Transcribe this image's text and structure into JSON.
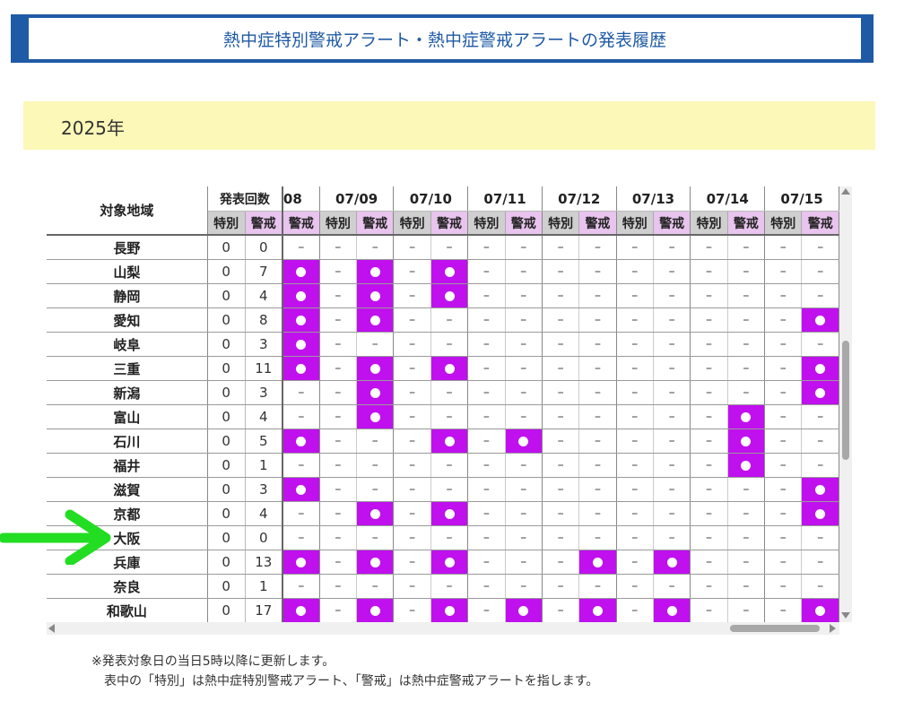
{
  "title": "熱中症特別警戒アラート・熱中症警戒アラートの発表履歴",
  "year": "2025年",
  "table": {
    "area_header": "対象地域",
    "count_header": "発表回数",
    "sub_special": "特別",
    "sub_warning": "警戒",
    "partial_date": "08",
    "dates": [
      "07/09",
      "07/10",
      "07/11",
      "07/12",
      "07/13",
      "07/14",
      "07/15"
    ],
    "dash": "–",
    "rows": [
      {
        "area": "長野",
        "special": "0",
        "warning": "0",
        "marks": [
          0,
          0,
          0,
          0,
          0,
          0,
          0,
          0,
          0,
          0,
          0,
          0,
          0,
          0,
          0
        ]
      },
      {
        "area": "山梨",
        "special": "0",
        "warning": "7",
        "marks": [
          1,
          0,
          1,
          0,
          1,
          0,
          0,
          0,
          0,
          0,
          0,
          0,
          0,
          0,
          0
        ]
      },
      {
        "area": "静岡",
        "special": "0",
        "warning": "4",
        "marks": [
          1,
          0,
          1,
          0,
          1,
          0,
          0,
          0,
          0,
          0,
          0,
          0,
          0,
          0,
          0
        ]
      },
      {
        "area": "愛知",
        "special": "0",
        "warning": "8",
        "marks": [
          1,
          0,
          1,
          0,
          0,
          0,
          0,
          0,
          0,
          0,
          0,
          0,
          0,
          0,
          1
        ]
      },
      {
        "area": "岐阜",
        "special": "0",
        "warning": "3",
        "marks": [
          1,
          0,
          0,
          0,
          0,
          0,
          0,
          0,
          0,
          0,
          0,
          0,
          0,
          0,
          0
        ]
      },
      {
        "area": "三重",
        "special": "0",
        "warning": "11",
        "marks": [
          1,
          0,
          1,
          0,
          1,
          0,
          0,
          0,
          0,
          0,
          0,
          0,
          0,
          0,
          1
        ]
      },
      {
        "area": "新潟",
        "special": "0",
        "warning": "3",
        "marks": [
          0,
          0,
          1,
          0,
          0,
          0,
          0,
          0,
          0,
          0,
          0,
          0,
          0,
          0,
          1
        ]
      },
      {
        "area": "富山",
        "special": "0",
        "warning": "4",
        "marks": [
          0,
          0,
          1,
          0,
          0,
          0,
          0,
          0,
          0,
          0,
          0,
          0,
          1,
          0,
          0
        ]
      },
      {
        "area": "石川",
        "special": "0",
        "warning": "5",
        "marks": [
          1,
          0,
          0,
          0,
          1,
          0,
          1,
          0,
          0,
          0,
          0,
          0,
          1,
          0,
          0
        ]
      },
      {
        "area": "福井",
        "special": "0",
        "warning": "1",
        "marks": [
          0,
          0,
          0,
          0,
          0,
          0,
          0,
          0,
          0,
          0,
          0,
          0,
          1,
          0,
          0
        ]
      },
      {
        "area": "滋賀",
        "special": "0",
        "warning": "3",
        "marks": [
          1,
          0,
          0,
          0,
          0,
          0,
          0,
          0,
          0,
          0,
          0,
          0,
          0,
          0,
          1
        ]
      },
      {
        "area": "京都",
        "special": "0",
        "warning": "4",
        "marks": [
          0,
          0,
          1,
          0,
          1,
          0,
          0,
          0,
          0,
          0,
          0,
          0,
          0,
          0,
          1
        ]
      },
      {
        "area": "大阪",
        "special": "0",
        "warning": "0",
        "marks": [
          0,
          0,
          0,
          0,
          0,
          0,
          0,
          0,
          0,
          0,
          0,
          0,
          0,
          0,
          0
        ]
      },
      {
        "area": "兵庫",
        "special": "0",
        "warning": "13",
        "marks": [
          1,
          0,
          1,
          0,
          1,
          0,
          0,
          0,
          1,
          0,
          1,
          0,
          0,
          0,
          0
        ]
      },
      {
        "area": "奈良",
        "special": "0",
        "warning": "1",
        "marks": [
          0,
          0,
          0,
          0,
          0,
          0,
          0,
          0,
          0,
          0,
          0,
          0,
          0,
          0,
          0
        ]
      },
      {
        "area": "和歌山",
        "special": "0",
        "warning": "17",
        "marks": [
          1,
          0,
          1,
          0,
          1,
          0,
          1,
          0,
          1,
          0,
          1,
          0,
          0,
          0,
          1
        ]
      }
    ]
  },
  "notes": {
    "line1": "※発表対象日の当日5時以降に更新します。",
    "line2": "表中の「特別」は熱中症特別警戒アラート、「警戒」は熱中症警戒アラートを指します。"
  },
  "colors": {
    "brand_blue": "#1f5aa6",
    "alert_purple": "#c010ee",
    "year_bg": "#fbf8b8",
    "arrow_green": "#22dd22"
  },
  "icons": {
    "pointer_arrow": "green-arrow-icon"
  }
}
